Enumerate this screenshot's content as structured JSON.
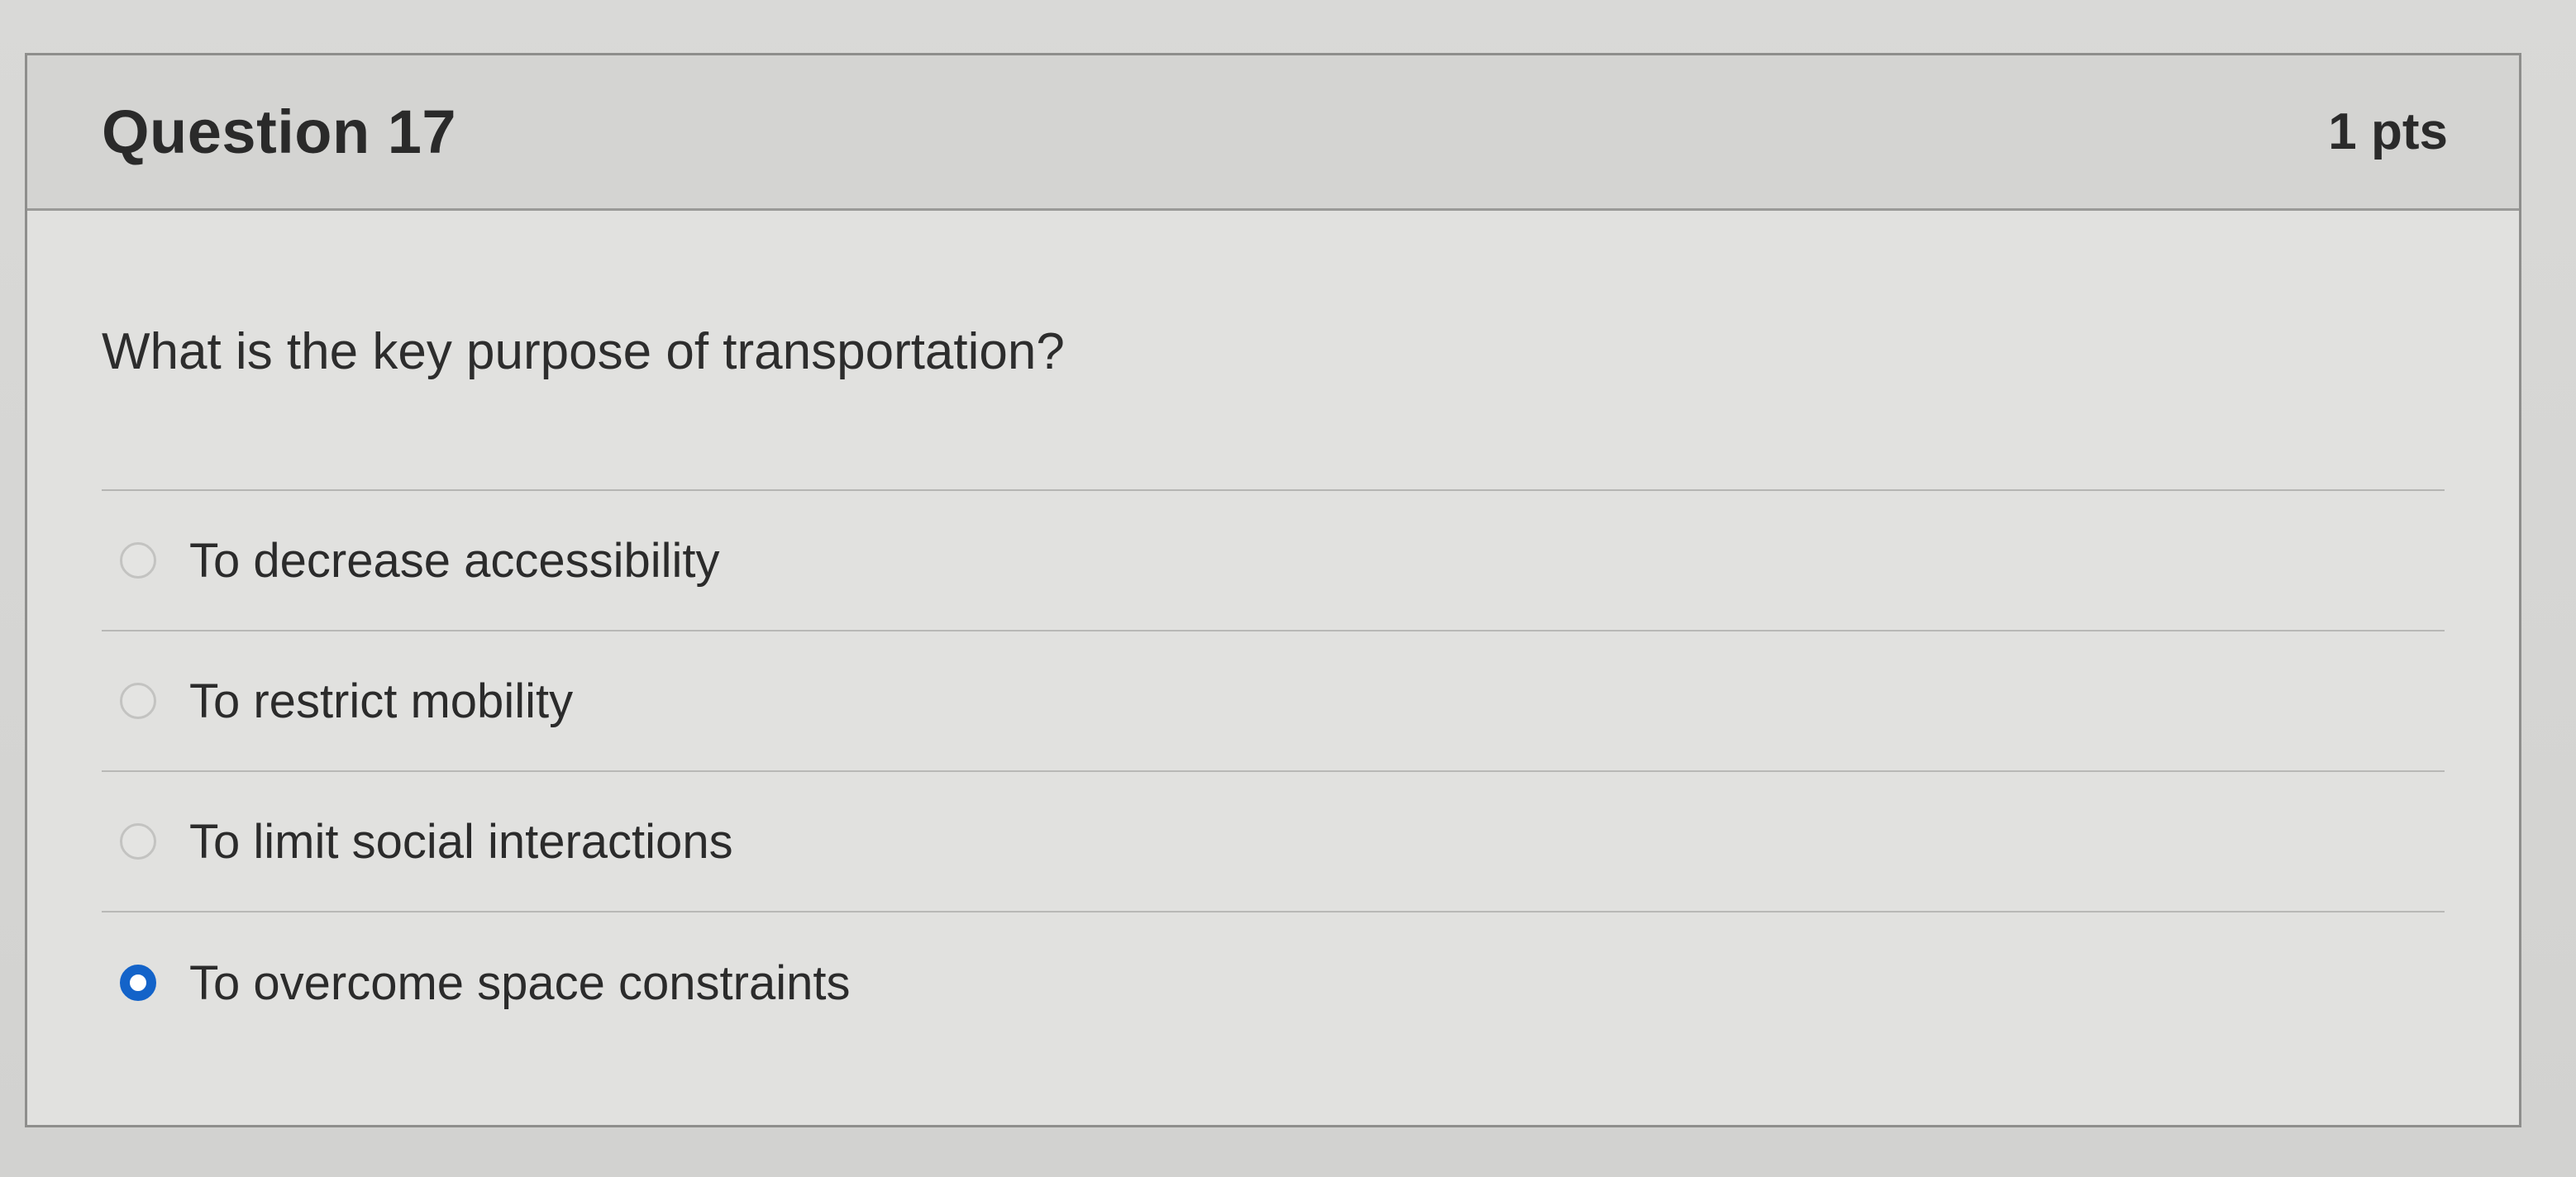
{
  "question": {
    "title": "Question 17",
    "points": "1 pts",
    "text": "What is the key purpose of transportation?"
  },
  "answers": [
    {
      "label": "To decrease accessibility",
      "selected": false
    },
    {
      "label": "To restrict mobility",
      "selected": false
    },
    {
      "label": "To limit social interactions",
      "selected": false
    },
    {
      "label": "To overcome space constraints",
      "selected": true
    }
  ],
  "colors": {
    "selected_radio": "#1363c9",
    "header_bg": "#d4d4d2",
    "card_bg": "#e1e1df"
  }
}
